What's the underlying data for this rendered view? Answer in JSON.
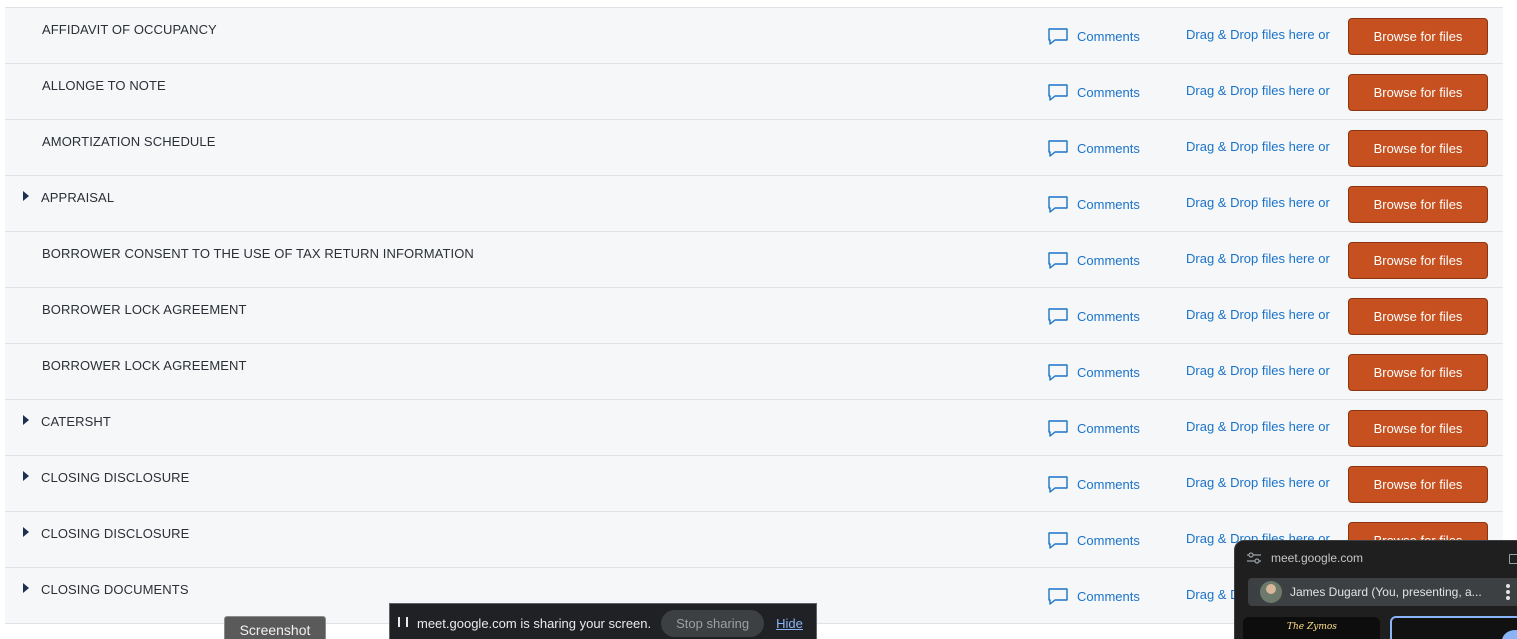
{
  "documents": {
    "rows": [
      {
        "title": "AFFIDAVIT OF OCCUPANCY",
        "expandable": false
      },
      {
        "title": "ALLONGE TO NOTE",
        "expandable": false
      },
      {
        "title": "AMORTIZATION SCHEDULE",
        "expandable": false
      },
      {
        "title": "APPRAISAL",
        "expandable": true
      },
      {
        "title": "BORROWER CONSENT TO THE USE OF TAX RETURN INFORMATION",
        "expandable": false
      },
      {
        "title": "BORROWER LOCK AGREEMENT",
        "expandable": false
      },
      {
        "title": "BORROWER LOCK AGREEMENT",
        "expandable": false
      },
      {
        "title": "CATERSHT",
        "expandable": true
      },
      {
        "title": "CLOSING DISCLOSURE",
        "expandable": true
      },
      {
        "title": "CLOSING DISCLOSURE",
        "expandable": true
      },
      {
        "title": "CLOSING DOCUMENTS",
        "expandable": true
      }
    ],
    "comments_label": "Comments",
    "dragdrop_label": "Drag & Drop files here or",
    "browse_label": "Browse for files",
    "colors": {
      "link": "#1a73c9",
      "browse_button": "#c6501f",
      "row_background": "#f5f7f9"
    }
  },
  "screenshot_tag": "Screenshot",
  "share_bar": {
    "message": "meet.google.com is sharing your screen.",
    "stop_label": "Stop sharing",
    "hide_label": "Hide"
  },
  "pip": {
    "domain": "meet.google.com",
    "presenter": "James Dugard (You, presenting, a...",
    "tile_caption": "The Zymos"
  }
}
